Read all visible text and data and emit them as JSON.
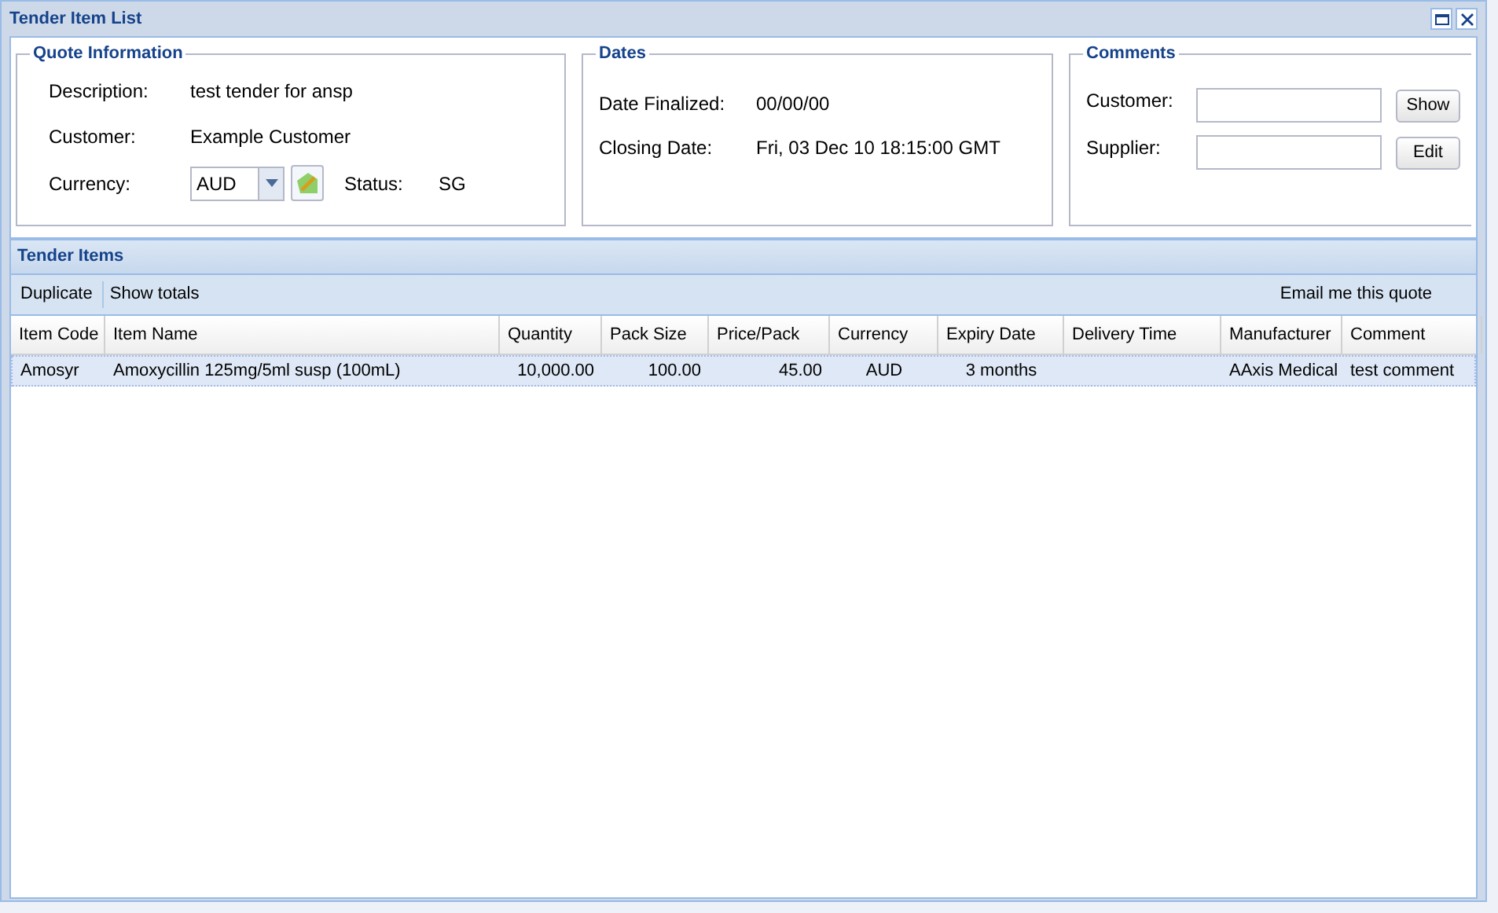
{
  "window": {
    "title": "Tender Item List"
  },
  "quote_information": {
    "title": "Quote Information",
    "fields": [
      {
        "label": "Description:",
        "value": "test tender for ansp"
      },
      {
        "label": "Customer:",
        "value": "Example Customer"
      }
    ],
    "currency": {
      "label": "Currency:",
      "value": "AUD"
    },
    "status": {
      "label": "Status:",
      "value": "SG"
    }
  },
  "dates": {
    "title": "Dates",
    "fields": [
      {
        "label": "Date Finalized:",
        "value": "00/00/00"
      },
      {
        "label": "Closing Date:",
        "value": "Fri, 03 Dec 10 18:15:00 GMT"
      }
    ]
  },
  "comments": {
    "title": "Comments",
    "rows": [
      {
        "label": "Customer:",
        "button": "Show"
      },
      {
        "label": "Supplier:",
        "button": "Edit"
      }
    ]
  },
  "tender_items": {
    "title": "Tender Items",
    "toolbar": [
      "Duplicate",
      "Show totals"
    ],
    "email": "Email me this quote",
    "columns": [
      "Item Code",
      "Item Name",
      "Quantity",
      "Pack Size",
      "Price/Pack",
      "Currency",
      "Expiry Date",
      "Delivery Time",
      "Manufacturer",
      "Comment"
    ],
    "rows": [
      {
        "selected": true,
        "cells": [
          "Amosyr",
          "Amoxycillin 125mg/5ml susp (100mL)",
          "10,000.00",
          "100.00",
          "45.00",
          "AUD",
          "3 months",
          "",
          "AAxis Medical",
          "test comment"
        ]
      }
    ]
  }
}
